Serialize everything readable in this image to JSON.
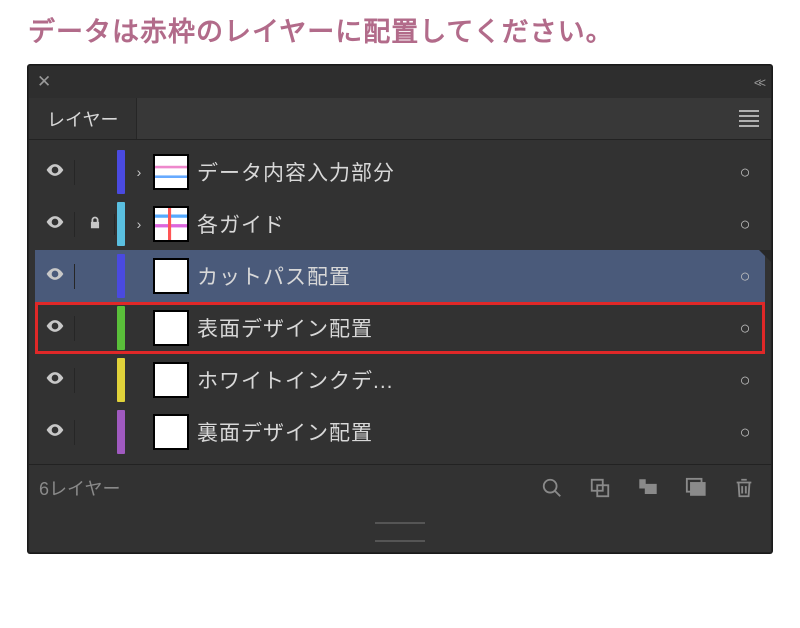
{
  "instruction": "データは赤枠のレイヤーに配置してください。",
  "panel": {
    "tab_label": "レイヤー"
  },
  "layers": [
    {
      "name": "データ内容入力部分",
      "color": "#4a4ae0",
      "locked": false,
      "expandable": true,
      "thumb": "content1",
      "selected": false,
      "highlighted": false
    },
    {
      "name": "各ガイド",
      "color": "#5abfe0",
      "locked": true,
      "expandable": true,
      "thumb": "content2",
      "selected": false,
      "highlighted": false
    },
    {
      "name": "カットパス配置",
      "color": "#4a4ae0",
      "locked": false,
      "expandable": false,
      "thumb": "blank",
      "selected": true,
      "highlighted": false
    },
    {
      "name": "表面デザイン配置",
      "color": "#5abf3a",
      "locked": false,
      "expandable": false,
      "thumb": "blank",
      "selected": false,
      "highlighted": true
    },
    {
      "name": "ホワイトインクデ...",
      "color": "#e0d23a",
      "locked": false,
      "expandable": false,
      "thumb": "blank",
      "selected": false,
      "highlighted": false
    },
    {
      "name": "裏面デザイン配置",
      "color": "#a05ac0",
      "locked": false,
      "expandable": false,
      "thumb": "blank",
      "selected": false,
      "highlighted": false
    }
  ],
  "footer": {
    "count_label": "6レイヤー"
  }
}
